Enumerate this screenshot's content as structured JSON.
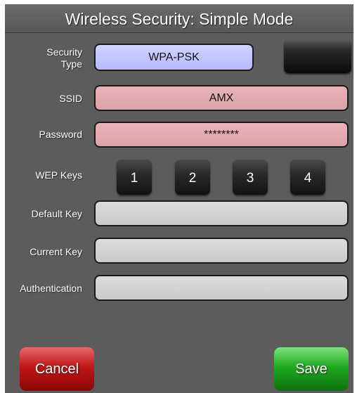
{
  "title": "Wireless Security: Simple Mode",
  "fields": {
    "security_type": {
      "label_line1": "Security",
      "label_line2": "Type",
      "value": "WPA-PSK"
    },
    "ssid": {
      "label": "SSID",
      "value": "AMX"
    },
    "password": {
      "label": "Password",
      "value": "********"
    },
    "wep_keys": {
      "label": "WEP Keys",
      "keys": [
        "1",
        "2",
        "3",
        "4"
      ]
    },
    "default_key": {
      "label": "Default Key",
      "value": ""
    },
    "current_key": {
      "label": "Current Key",
      "value": ""
    },
    "authentication": {
      "label": "Authentication",
      "value": ""
    }
  },
  "buttons": {
    "cancel": "Cancel",
    "save": "Save"
  },
  "colors": {
    "panel_bg": "#5c5c5c",
    "security_type_field": "#c4c7ff",
    "ssid_password_field": "#e3abb0",
    "empty_field": "#d3d3d3",
    "cancel": "#c11616",
    "save": "#1fa91f"
  }
}
